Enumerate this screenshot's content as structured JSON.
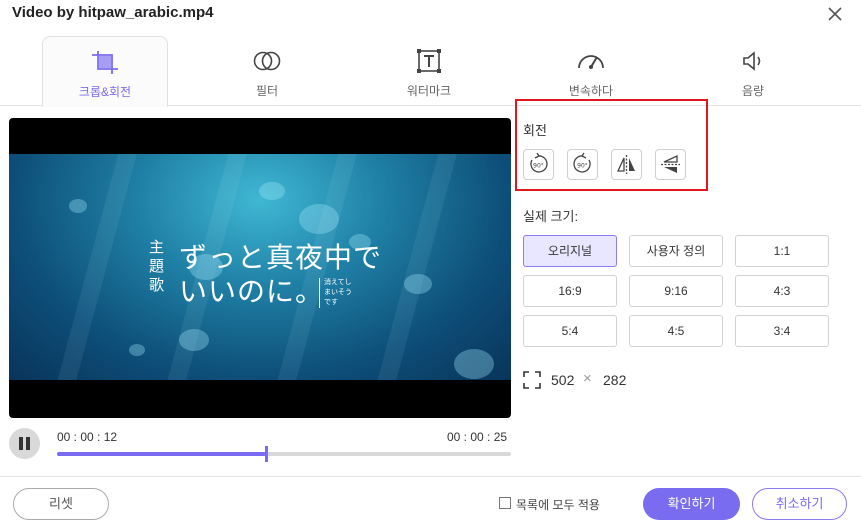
{
  "window": {
    "title": "Video by hitpaw_arabic.mp4",
    "close_icon": "close-icon"
  },
  "tabs": [
    {
      "label": "크롭&회전",
      "icon": "crop-icon",
      "active": true
    },
    {
      "label": "필터",
      "icon": "filter-icon",
      "active": false
    },
    {
      "label": "워터마크",
      "icon": "watermark-icon",
      "active": false
    },
    {
      "label": "변속하다",
      "icon": "speedometer-icon",
      "active": false
    },
    {
      "label": "음량",
      "icon": "volume-icon",
      "active": false
    }
  ],
  "video": {
    "side_text": "主題歌",
    "line1": "ずっと真夜中で",
    "line2": "いいのに。",
    "small_text": "消えてしまいそうです"
  },
  "player": {
    "current_time": "00 : 00 : 12",
    "total_time": "00 : 00 : 25",
    "progress": 0.46
  },
  "rotate": {
    "label": "회전",
    "buttons": [
      {
        "name": "rotate-left-90-icon",
        "text": "90°"
      },
      {
        "name": "rotate-right-90-icon",
        "text": "90°"
      },
      {
        "name": "flip-horizontal-icon"
      },
      {
        "name": "flip-vertical-icon"
      }
    ]
  },
  "size": {
    "label": "실제 크기:",
    "options": [
      "오리지널",
      "사용자 정의",
      "1:1",
      "16:9",
      "9:16",
      "4:3",
      "5:4",
      "4:5",
      "3:4"
    ],
    "selected": "오리지널",
    "width": "502",
    "times": "×",
    "height": "282"
  },
  "footer": {
    "reset_label": "리셋",
    "apply_all_label": "목록에 모두 적용",
    "confirm_label": "확인하기",
    "cancel_label": "취소하기"
  },
  "colors": {
    "accent": "#7a6cf0",
    "highlight": "#e0181e"
  }
}
